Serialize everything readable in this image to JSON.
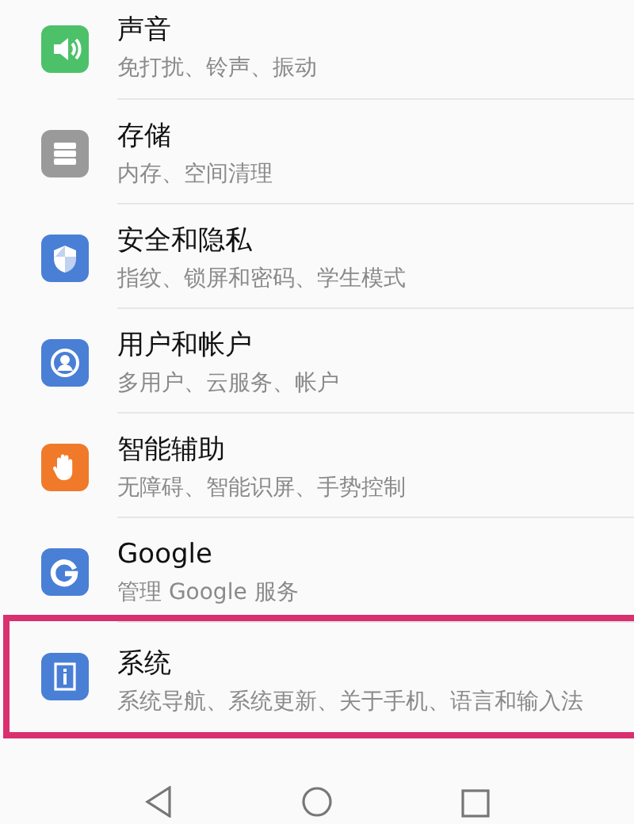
{
  "settings": [
    {
      "title": "声音",
      "subtitle": "免打扰、铃声、振动",
      "color": "#4cc16a",
      "highlighted": false
    },
    {
      "title": "存储",
      "subtitle": "内存、空间清理",
      "color": "#9a9a9a",
      "highlighted": false
    },
    {
      "title": "安全和隐私",
      "subtitle": "指纹、锁屏和密码、学生模式",
      "color": "#4a7fd6",
      "highlighted": false
    },
    {
      "title": "用户和帐户",
      "subtitle": "多用户、云服务、帐户",
      "color": "#4a7fd6",
      "highlighted": false
    },
    {
      "title": "智能辅助",
      "subtitle": "无障碍、智能识屏、手势控制",
      "color": "#f07a2a",
      "highlighted": false
    },
    {
      "title": "Google",
      "subtitle": "管理 Google 服务",
      "color": "#4a7fd6",
      "highlighted": false
    },
    {
      "title": "系统",
      "subtitle": "系统导航、系统更新、关于手机、语言和输入法",
      "color": "#4a7fd6",
      "highlighted": true
    }
  ]
}
